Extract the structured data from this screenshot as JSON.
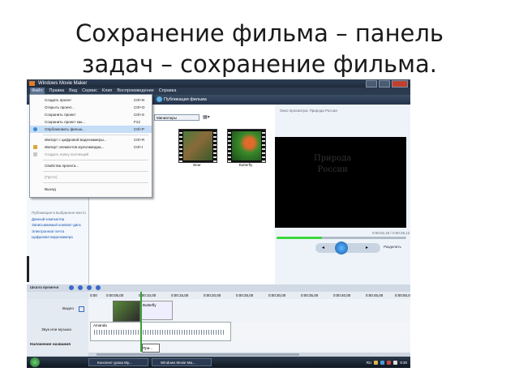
{
  "slide": {
    "title_line1": "Сохранение фильма – панель",
    "title_line2": "задач – сохранение фильма."
  },
  "window": {
    "title": "Windows Movie Maker"
  },
  "menubar": {
    "items": [
      "Файл",
      "Правка",
      "Вид",
      "Сервис",
      "Клип",
      "Воспроизведение",
      "Справка"
    ]
  },
  "toolbar": {
    "publish_label": "Публикация фильма"
  },
  "file_menu": {
    "items": [
      {
        "label": "Создать проект",
        "shortcut": "Ctrl+N"
      },
      {
        "label": "Открыть проект...",
        "shortcut": "Ctrl+O"
      },
      {
        "label": "Сохранить проект",
        "shortcut": "Ctrl+S"
      },
      {
        "label": "Сохранить проект как...",
        "shortcut": "F12"
      },
      {
        "label": "Опубликовать фильм...",
        "shortcut": "Ctrl+P"
      },
      {
        "label": "Импорт с цифровой видеокамеры...",
        "shortcut": "Ctrl+R"
      },
      {
        "label": "Импорт элементов мультимедиа...",
        "shortcut": "Ctrl+I"
      },
      {
        "label": "Создать папку коллекций",
        "shortcut": ""
      },
      {
        "label": "Свойства проекта...",
        "shortcut": ""
      },
      {
        "label": "(Пусто)",
        "shortcut": ""
      },
      {
        "label": "Выход",
        "shortcut": ""
      }
    ]
  },
  "collection": {
    "view_label": "Миниатюры",
    "clips": [
      {
        "label": "Bear"
      },
      {
        "label": "Butterfly"
      }
    ]
  },
  "tasks": {
    "heading": "Публикация в выбранное место",
    "links": [
      "Данный компьютер",
      "Записываемый компакт-диск",
      "Электронная почта",
      "Цифровая видеокамера"
    ]
  },
  "preview": {
    "title": "Окно просмотра: Природа России",
    "overlay_text_1": "Природа",
    "overlay_text_2": "России",
    "timecode": "0:00:02,18 / 0:00:28,12",
    "progress": 0.35,
    "split_label": "Разделить"
  },
  "timeline": {
    "label": "Шкала времени",
    "ruler": [
      "0:00",
      "0:00:05,00",
      "0:00:10,00",
      "0:00:15,00",
      "0:00:20,00",
      "0:00:25,00",
      "0:00:30,00",
      "0:00:35,00",
      "0:00:40,00",
      "0:00:45,00",
      "0:00:50,00"
    ],
    "video_track": "Видео",
    "audio_track": "Звук или музыка",
    "title_track": "Наложение названия",
    "video_clip_label": "Butterfly",
    "audio_clip_label": "Amanda",
    "title_clip_label": "При..."
  },
  "taskbar": {
    "buttons": [
      "Конспект урока My...",
      "Windows Movie Ma..."
    ],
    "lang": "RU",
    "clock": "9:30"
  }
}
